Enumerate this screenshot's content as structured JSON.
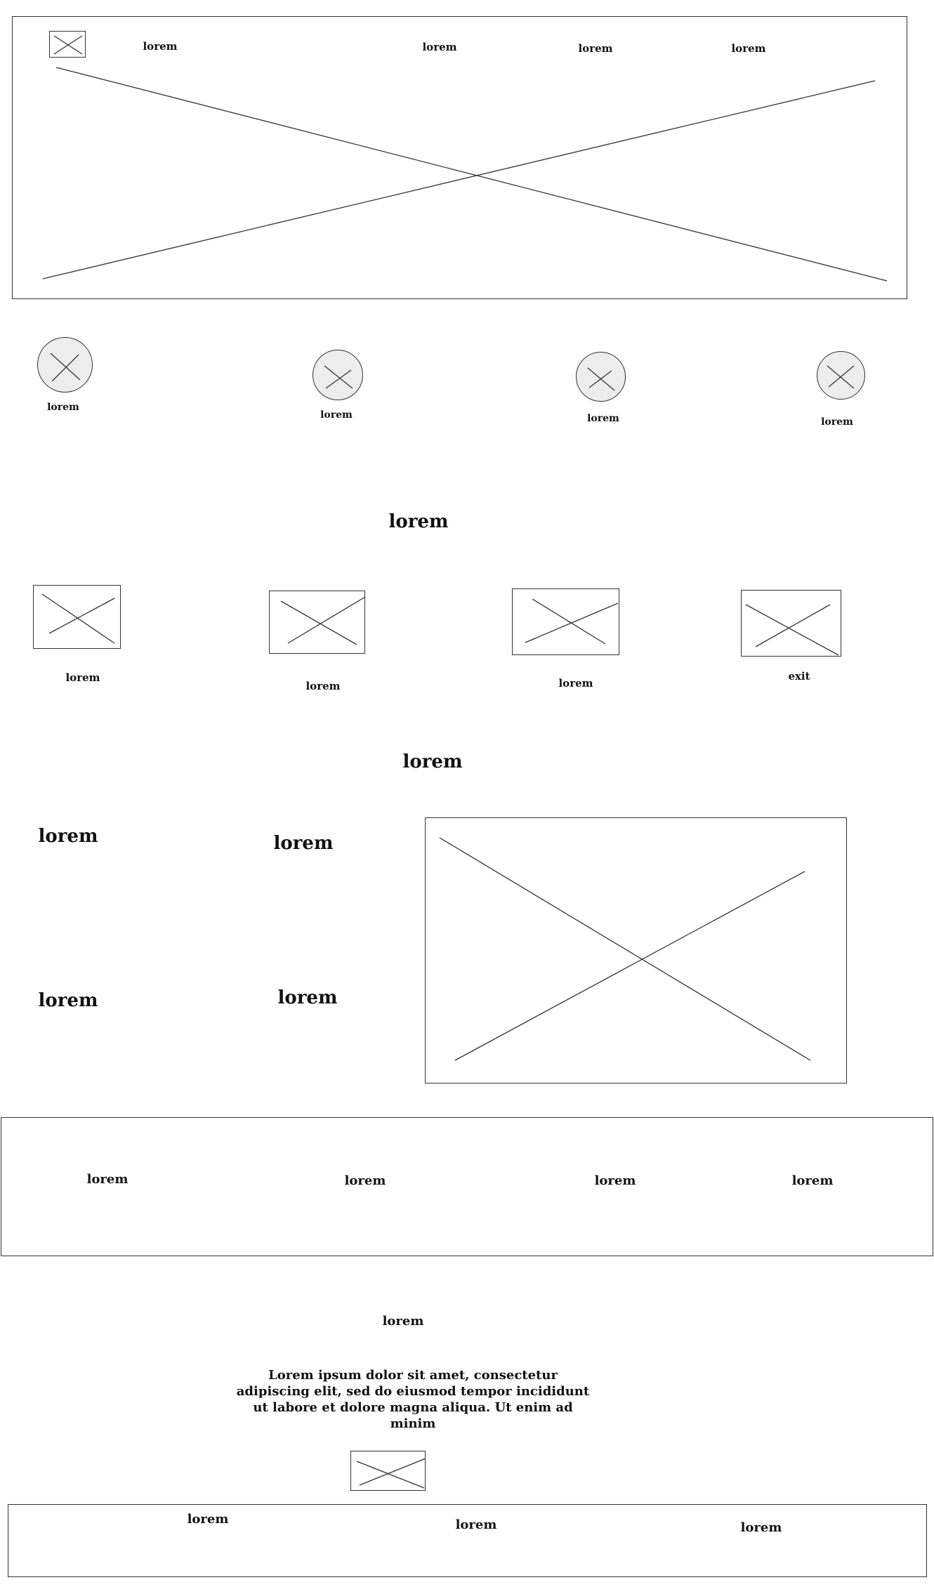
{
  "header": {
    "nav": [
      "lorem",
      "lorem",
      "lorem",
      "lorem"
    ]
  },
  "categories": {
    "items": [
      "lorem",
      "lorem",
      "lorem",
      "lorem"
    ]
  },
  "section_one": {
    "title": "lorem",
    "cards": [
      "lorem",
      "lorem",
      "lorem",
      "exit"
    ]
  },
  "section_two": {
    "title": "lorem",
    "features": [
      "lorem",
      "lorem",
      "lorem",
      "lorem"
    ]
  },
  "band": {
    "links": [
      "lorem",
      "lorem",
      "lorem",
      "lorem"
    ]
  },
  "about": {
    "title": "lorem",
    "paragraph": "Lorem ipsum dolor sit amet, consectetur adipiscing elit, sed do eiusmod tempor incididunt ut labore et dolore magna aliqua. Ut enim ad minim"
  },
  "footer": {
    "links": [
      "lorem",
      "lorem",
      "lorem"
    ]
  }
}
